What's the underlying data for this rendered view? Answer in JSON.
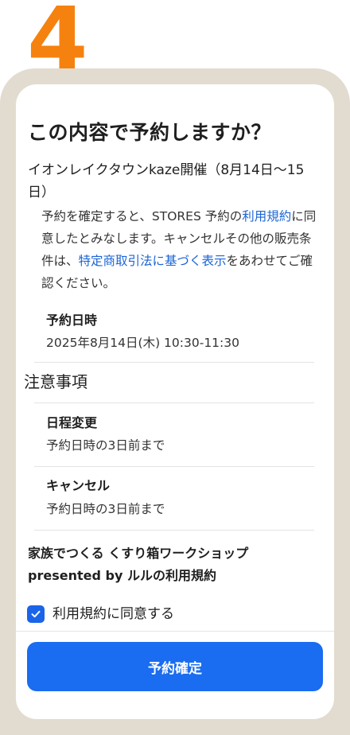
{
  "step": {
    "number": "4",
    "color": "#f5820f"
  },
  "dialog": {
    "title": "この内容で予約しますか？",
    "event_name": "イオンレイクタウンkaze開催（8月14日〜15日）",
    "consent": {
      "part1": "予約を確定すると、STORES 予約の",
      "link1": "利用規約",
      "part2": "に同意したとみなします。キャンセルその他の販売条件は、",
      "link2": "特定商取引法に基づく表示",
      "part3": "をあわせてご確認ください。"
    },
    "reservation": {
      "label": "予約日時",
      "value": "2025年8月14日(木) 10:30-11:30"
    },
    "notes_heading": "注意事項",
    "reschedule": {
      "label": "日程変更",
      "value": "予約日時の3日前まで"
    },
    "cancel": {
      "label": "キャンセル",
      "value": "予約日時の3日前まで"
    },
    "terms_title": "家族でつくる くすり箱ワークショップ presented by ルルの利用規約",
    "agree_label": "利用規約に同意する",
    "agree_checked": true,
    "confirm_button": "予約確定"
  },
  "colors": {
    "accent": "#1a6cf0",
    "link": "#1a64d6",
    "frame": "#e2dcd0"
  },
  "icons": {
    "checkbox": "check-icon"
  }
}
